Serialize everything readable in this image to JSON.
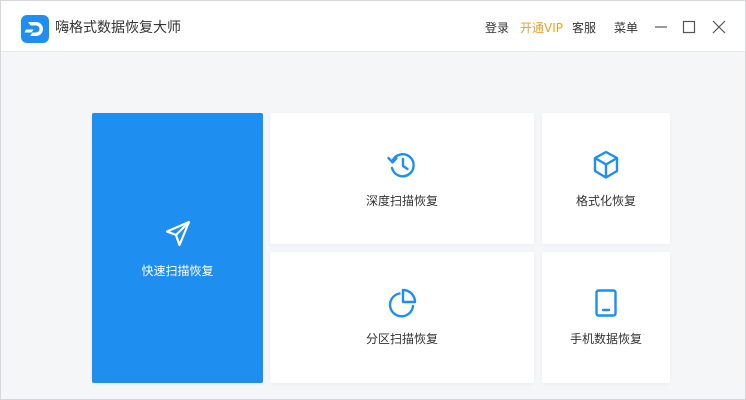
{
  "app": {
    "title": "嗨格式数据恢复大师",
    "logo_icon": "d-logo-icon"
  },
  "header": {
    "login_label": "登录",
    "vip_label": "开通VIP",
    "service_label": "客服",
    "menu_label": "菜单"
  },
  "window_controls": {
    "minimize_icon": "minimize-icon",
    "maximize_icon": "maximize-icon",
    "close_icon": "close-icon"
  },
  "colors": {
    "accent": "#1e8ef0",
    "vip": "#f0a020"
  },
  "modes": {
    "quick_scan": {
      "label": "快速扫描恢复",
      "icon": "navigation-arrow-icon"
    },
    "deep_scan": {
      "label": "深度扫描恢复",
      "icon": "history-icon"
    },
    "format_recovery": {
      "label": "格式化恢复",
      "icon": "cube-icon"
    },
    "partition_scan": {
      "label": "分区扫描恢复",
      "icon": "pie-chart-icon"
    },
    "phone_recovery": {
      "label": "手机数据恢复",
      "icon": "tablet-icon"
    }
  }
}
